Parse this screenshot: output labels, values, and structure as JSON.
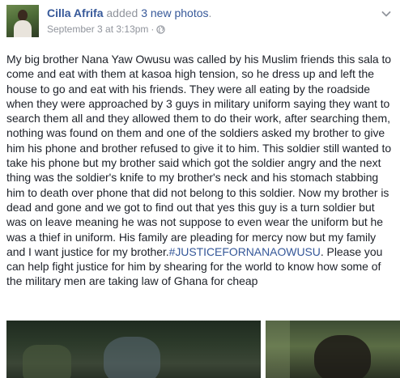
{
  "header": {
    "author": "Cilla Afrifa",
    "action": " added ",
    "photos_link": "3 new photos",
    "period": ".",
    "timestamp": "September 3 at 3:13pm",
    "separator": "·",
    "privacy_icon": "globe-icon",
    "menu_icon": "chevron-down-icon"
  },
  "post": {
    "body": "My big brother Nana Yaw Owusu was called by his Muslim friends this sala to come and eat with them at kasoa high tension, so he dress up and left the house to go and eat with his friends. They were all eating by the roadside when they were approached by 3 guys in military uniform saying they want to search them all and they allowed them to do their work, after searching them, nothing was found on them and one of the soldiers asked my brother to give him his phone and brother refused to give it to him. This soldier still wanted to take his phone but my brother said which got the soldier angry and the next thing was the soldier's knife to my brother's neck and his stomach stabbing him to death over phone that did not belong to this soldier. Now my brother is dead and gone and we got to find out that yes this guy is a turn soldier but was on leave meaning he was not suppose to even wear the uniform but he was a thief in uniform. His family are pleading for mercy now but my family and I want justice for my brother.",
    "hashtag": "#JUSTICEFORNANAOWUSU",
    "ending": ". Please you can help fight justice for him by shearing for the world to know how some of the military men are taking law of Ghana for cheap"
  },
  "colors": {
    "link": "#365899",
    "meta": "#90949c",
    "text": "#1d2129"
  }
}
